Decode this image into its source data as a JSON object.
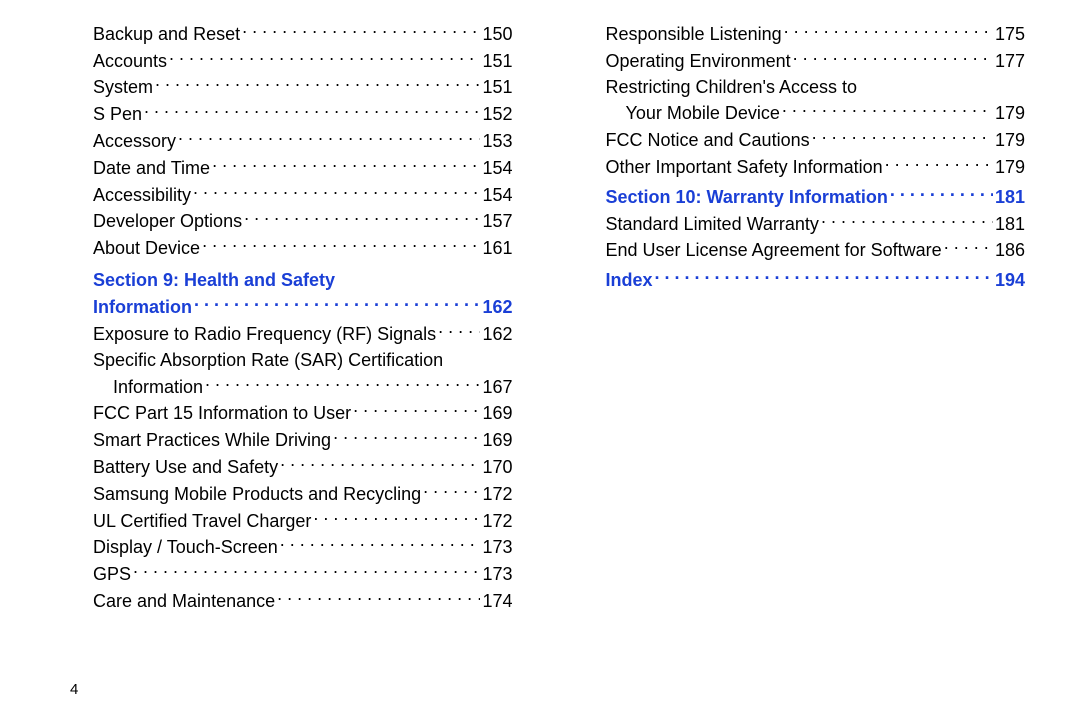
{
  "footer_page_number": "4",
  "left_column": [
    {
      "type": "item",
      "indent": 1,
      "label": "Backup and Reset",
      "page": "150"
    },
    {
      "type": "item",
      "indent": 1,
      "label": "Accounts",
      "page": "151"
    },
    {
      "type": "item",
      "indent": 1,
      "label": "System",
      "page": "151"
    },
    {
      "type": "item",
      "indent": 1,
      "label": "S Pen",
      "page": "152"
    },
    {
      "type": "item",
      "indent": 1,
      "label": "Accessory",
      "page": "153"
    },
    {
      "type": "item",
      "indent": 1,
      "label": "Date and Time",
      "page": "154"
    },
    {
      "type": "item",
      "indent": 1,
      "label": "Accessibility",
      "page": "154"
    },
    {
      "type": "item",
      "indent": 1,
      "label": "Developer Options",
      "page": "157"
    },
    {
      "type": "item",
      "indent": 1,
      "label": "About Device",
      "page": "161"
    },
    {
      "type": "section_head",
      "indent": 0,
      "label": "Section 9:  Health and Safety"
    },
    {
      "type": "section_tail",
      "indent": 1,
      "label": "Information",
      "page": "162"
    },
    {
      "type": "item",
      "indent": 1,
      "label": "Exposure to Radio Frequency (RF) Signals",
      "page": "162"
    },
    {
      "type": "cont_head",
      "indent": 1,
      "label": "Specific Absorption Rate (SAR) Certification"
    },
    {
      "type": "cont_tail",
      "indent": 2,
      "label": "Information",
      "page": "167"
    },
    {
      "type": "item",
      "indent": 1,
      "label": "FCC Part 15 Information to User",
      "page": "169"
    },
    {
      "type": "item",
      "indent": 1,
      "label": "Smart Practices While Driving",
      "page": "169"
    },
    {
      "type": "item",
      "indent": 1,
      "label": "Battery Use and Safety",
      "page": "170"
    },
    {
      "type": "item",
      "indent": 1,
      "label": "Samsung Mobile Products and Recycling",
      "page": "172"
    },
    {
      "type": "item",
      "indent": 1,
      "label": "UL Certified Travel Charger",
      "page": "172"
    },
    {
      "type": "item",
      "indent": 1,
      "label": "Display / Touch-Screen",
      "page": "173"
    },
    {
      "type": "item",
      "indent": 1,
      "label": "GPS",
      "page": "173"
    },
    {
      "type": "item",
      "indent": 1,
      "label": "Care and Maintenance",
      "page": "174"
    }
  ],
  "right_column": [
    {
      "type": "item",
      "indent": 1,
      "label": "Responsible Listening",
      "page": "175"
    },
    {
      "type": "item",
      "indent": 1,
      "label": "Operating Environment",
      "page": "177"
    },
    {
      "type": "cont_head",
      "indent": 1,
      "label": "Restricting Children's Access to"
    },
    {
      "type": "cont_tail",
      "indent": 2,
      "label": "Your Mobile Device",
      "page": "179"
    },
    {
      "type": "item",
      "indent": 1,
      "label": "FCC Notice and Cautions",
      "page": "179"
    },
    {
      "type": "item",
      "indent": 1,
      "label": "Other Important Safety Information",
      "page": "179"
    },
    {
      "type": "section",
      "indent": 0,
      "label": "Section 10:  Warranty Information",
      "page": "181"
    },
    {
      "type": "item",
      "indent": 1,
      "label": "Standard Limited Warranty",
      "page": "181"
    },
    {
      "type": "item",
      "indent": 1,
      "label": "End User License Agreement for Software",
      "page": "186"
    },
    {
      "type": "section",
      "indent": 0,
      "label": "Index",
      "page": "194"
    }
  ]
}
